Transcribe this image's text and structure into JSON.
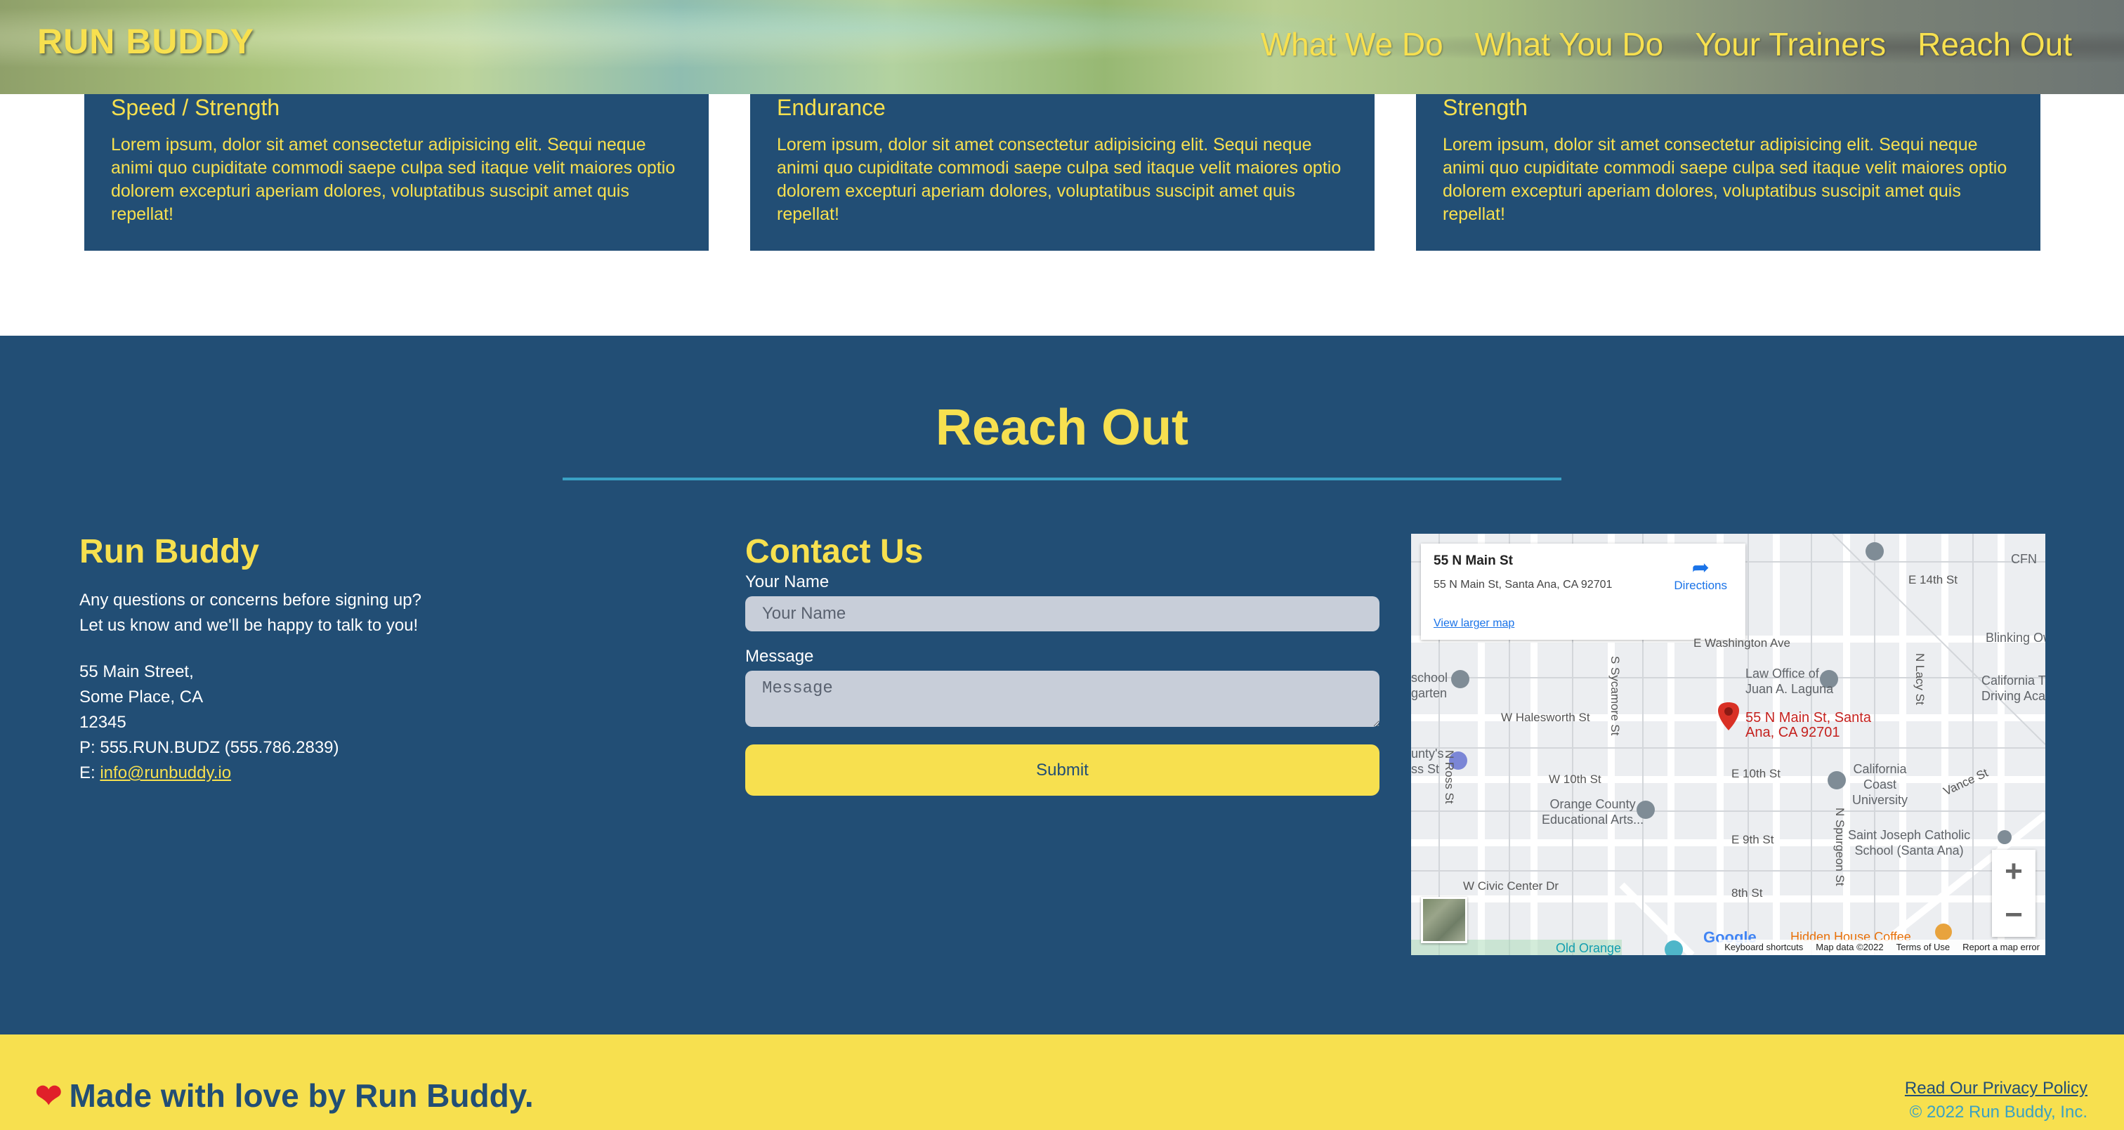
{
  "header": {
    "logo": "RUN BUDDY",
    "nav": [
      "What We Do",
      "What You Do",
      "Your Trainers",
      "Reach Out"
    ]
  },
  "cards": [
    {
      "title": "Speed / Strength",
      "text": "Lorem ipsum, dolor sit amet consectetur adipisicing elit. Sequi neque animi quo cupiditate commodi saepe culpa sed itaque velit maiores optio dolorem excepturi aperiam dolores, voluptatibus suscipit amet quis repellat!"
    },
    {
      "title": "Endurance",
      "text": "Lorem ipsum, dolor sit amet consectetur adipisicing elit. Sequi neque animi quo cupiditate commodi saepe culpa sed itaque velit maiores optio dolorem excepturi aperiam dolores, voluptatibus suscipit amet quis repellat!"
    },
    {
      "title": "Strength",
      "text": "Lorem ipsum, dolor sit amet consectetur adipisicing elit. Sequi neque animi quo cupiditate commodi saepe culpa sed itaque velit maiores optio dolorem excepturi aperiam dolores, voluptatibus suscipit amet quis repellat!"
    }
  ],
  "reach": {
    "title": "Reach Out",
    "info": {
      "title": "Run Buddy",
      "line1": "Any questions or concerns before signing up?",
      "line2": "Let us know and we'll be happy to talk to you!",
      "street": "55 Main Street,",
      "city": "Some Place, CA",
      "zip": "12345",
      "phone": "P: 555.RUN.BUDZ (555.786.2839)",
      "email_prefix": "E: ",
      "email": "info@runbuddy.io"
    },
    "contact": {
      "title": "Contact Us",
      "name_label": "Your Name",
      "name_placeholder": "Your Name",
      "message_label": "Message",
      "message_placeholder": "Message",
      "submit": "Submit"
    },
    "map": {
      "place_title": "55 N Main St",
      "place_addr": "55 N Main St, Santa Ana, CA 92701",
      "directions": "Directions",
      "larger_map": "View larger map",
      "pin_label_1": "55 N Main St, Santa",
      "pin_label_2": "Ana, CA 92701",
      "streets": {
        "e14th": "E 14th St",
        "ewashington": "E Washington Ave",
        "whalesworth": "W Halesworth St",
        "w10th": "W 10th St",
        "e10th": "E 10th St",
        "e9th": "E 9th St",
        "s8th": "8th St",
        "wciviccenter": "W Civic Center Dr",
        "nross": "N Ross St",
        "ssycamore": "S Sycamore St",
        "nlacy": "N Lacy St",
        "nspurgeon": "N Spurgeon St",
        "vance": "Vance St"
      },
      "pois": {
        "law_office_1": "Law Office of",
        "law_office_2": "Juan A. Laguna",
        "orange_county_1": "Orange County",
        "orange_county_2": "Educational Arts...",
        "california_coast_1": "California",
        "california_coast_2": "Coast",
        "california_coast_3": "University",
        "saint_joseph_1": "Saint Joseph Catholic",
        "saint_joseph_2": "School (Santa Ana)",
        "blinking_owl": "Blinking Ow",
        "california_tru_1": "California Tru",
        "california_tru_2": "Driving Acade",
        "school_1": "school",
        "school_2": "garten",
        "county_1": "unty's",
        "county_2": "ss St",
        "cfn": "CFN",
        "hidden_house": "Hidden House Coffee",
        "old_orange": "Old Orange"
      },
      "footer": [
        "Keyboard shortcuts",
        "Map data ©2022",
        "Terms of Use",
        "Report a map error"
      ],
      "google": "Google"
    }
  },
  "footer": {
    "made_with": "Made with love by Run Buddy.",
    "privacy": "Read Our Privacy Policy",
    "copyright": "© 2022 Run Buddy, Inc."
  },
  "colors": {
    "navy": "#224e75",
    "yellow": "#f7e04f",
    "teal": "#3aa1c4"
  }
}
